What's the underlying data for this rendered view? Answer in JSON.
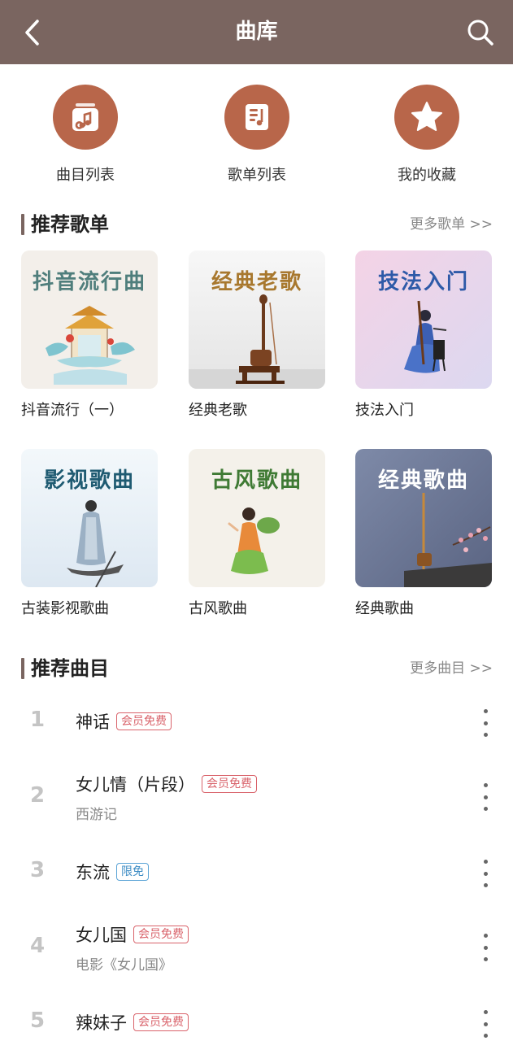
{
  "header": {
    "title": "曲库",
    "back_icon": "chevron-left-icon",
    "search_icon": "search-icon"
  },
  "quick_links": [
    {
      "label": "曲目列表",
      "icon": "music-album-icon"
    },
    {
      "label": "歌单列表",
      "icon": "song-sheet-icon"
    },
    {
      "label": "我的收藏",
      "icon": "star-icon"
    }
  ],
  "recommend_playlists": {
    "heading": "推荐歌单",
    "more": "更多歌单 >>",
    "items": [
      {
        "cover_title": "抖音流行曲",
        "name": "抖音流行（一）"
      },
      {
        "cover_title": "经典老歌",
        "name": "经典老歌"
      },
      {
        "cover_title": "技法入门",
        "name": "技法入门"
      },
      {
        "cover_title": "影视歌曲",
        "name": "古装影视歌曲"
      },
      {
        "cover_title": "古风歌曲",
        "name": "古风歌曲"
      },
      {
        "cover_title": "经典歌曲",
        "name": "经典歌曲"
      }
    ]
  },
  "recommend_songs": {
    "heading": "推荐曲目",
    "more": "更多曲目 >>",
    "items": [
      {
        "num": "1",
        "title": "神话",
        "badge": "会员免费",
        "subtitle": ""
      },
      {
        "num": "2",
        "title": "女儿情（片段）",
        "badge": "会员免费",
        "subtitle": "西游记"
      },
      {
        "num": "3",
        "title": "东流",
        "badge": "限免",
        "subtitle": ""
      },
      {
        "num": "4",
        "title": "女儿国",
        "badge": "会员免费",
        "subtitle": "电影《女儿国》"
      },
      {
        "num": "5",
        "title": "辣妹子",
        "badge": "会员免费",
        "subtitle": ""
      }
    ]
  },
  "colors": {
    "header_bg": "#7a6560",
    "accent_circle": "#b8664a",
    "badge_member": "#d9636b",
    "badge_free": "#3d8cc4"
  }
}
